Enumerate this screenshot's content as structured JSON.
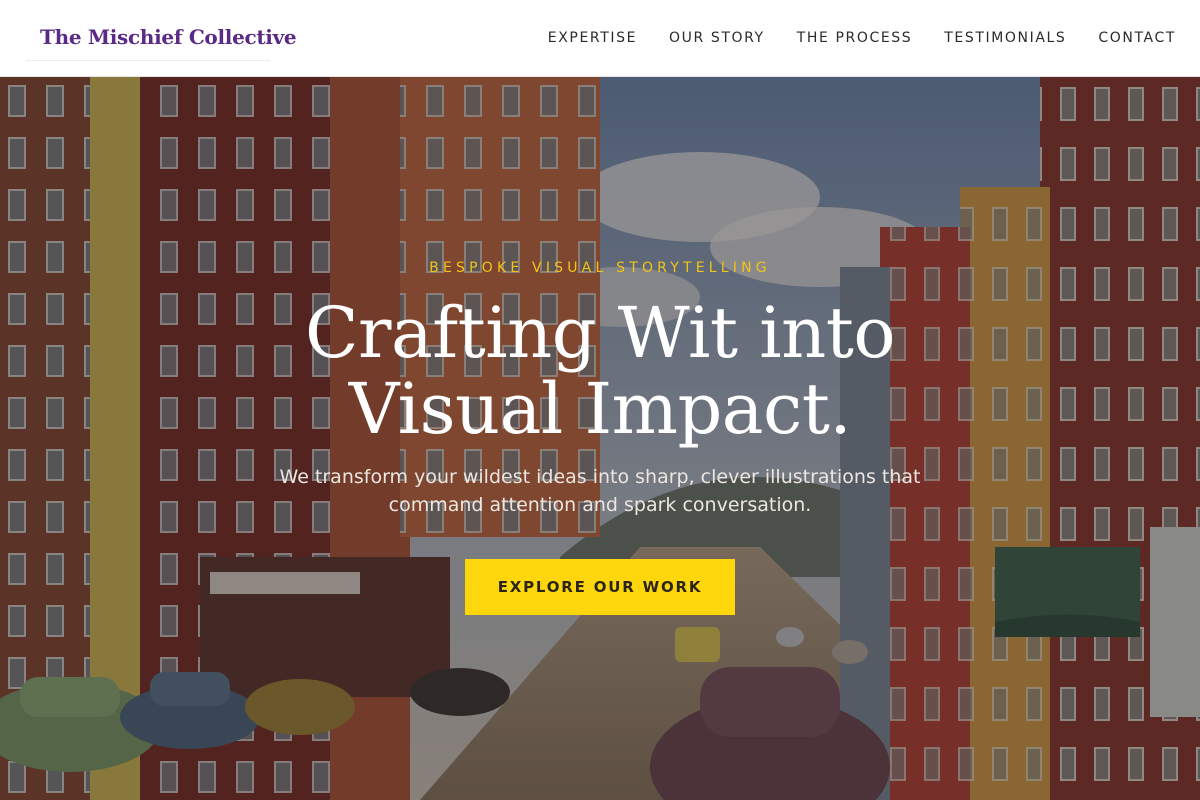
{
  "header": {
    "logo": "The Mischief Collective",
    "nav": [
      {
        "label": "EXPERTISE"
      },
      {
        "label": "OUR STORY"
      },
      {
        "label": "THE PROCESS"
      },
      {
        "label": "TESTIMONIALS"
      },
      {
        "label": "CONTACT"
      }
    ]
  },
  "hero": {
    "eyebrow": "BESPOKE VISUAL STORYTELLING",
    "headline": "Crafting Wit into Visual Impact.",
    "subtext": "We transform your wildest ideas into sharp, clever illustrations that command attention and spark conversation.",
    "cta_label": "EXPLORE OUR WORK",
    "background_image": "vintage-street-postcard-image"
  },
  "colors": {
    "brand": "#5b2a86",
    "accent": "#fdd60b",
    "eyebrow": "#f2c417",
    "header_bg": "#ffffff"
  }
}
